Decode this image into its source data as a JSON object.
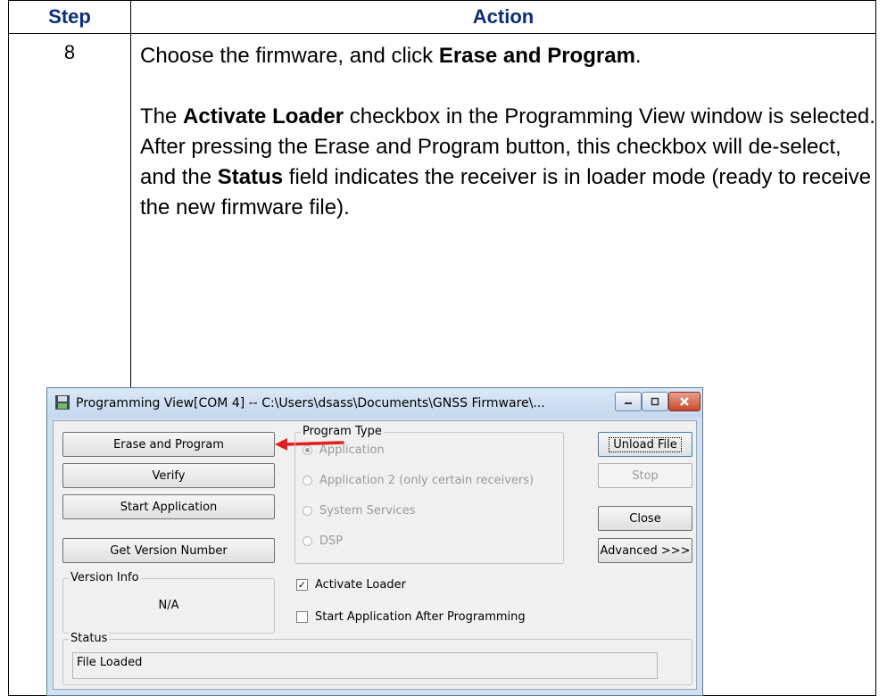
{
  "table": {
    "header_step": "Step",
    "header_action": "Action",
    "step_number": "8",
    "para1_prefix": "Choose the firmware, and click ",
    "para1_bold": "Erase and Program",
    "para1_suffix": ".",
    "para2_a": "The ",
    "para2_bold1": "Activate Loader",
    "para2_b": " checkbox in the Programming View window is selected. After pressing the Erase and Program button, this checkbox will de-select, and the ",
    "para2_bold2": "Status",
    "para2_c": " field indicates the receiver is in loader mode (ready to receive the new firmware file)."
  },
  "dialog": {
    "title": "Programming View[COM 4] -- C:\\Users\\dsass\\Documents\\GNSS Firmware\\...",
    "buttons": {
      "erase_program": "Erase and Program",
      "verify": "Verify",
      "start_application": "Start Application",
      "get_version": "Get Version Number",
      "unload_file": "Unload File",
      "stop": "Stop",
      "close": "Close",
      "advanced": "Advanced >>>"
    },
    "program_type": {
      "label": "Program Type",
      "options": [
        "Application",
        "Application 2 (only certain receivers)",
        "System Services",
        "DSP"
      ],
      "selected": "Application"
    },
    "version_info": {
      "label": "Version Info",
      "value": "N/A"
    },
    "checkboxes": {
      "activate_loader": "Activate Loader",
      "activate_loader_checked": true,
      "start_after": "Start Application After Programming",
      "start_after_checked": false
    },
    "status": {
      "label": "Status",
      "value": "File Loaded"
    }
  },
  "colors": {
    "header_text": "#0a2e7a",
    "arrow": "#e02020"
  }
}
